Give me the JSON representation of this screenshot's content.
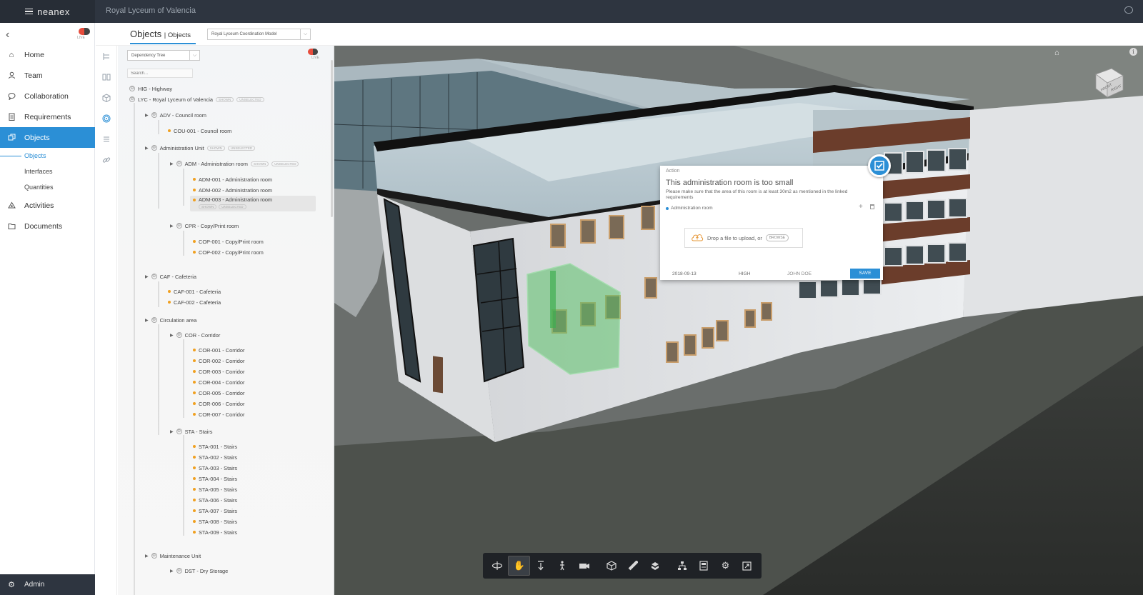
{
  "app": {
    "brand": "neanex",
    "project_title": "Royal Lyceum of Valencia"
  },
  "sidebar": {
    "toggle_label": "LIVE",
    "items": [
      {
        "label": "Home",
        "icon": "home-icon"
      },
      {
        "label": "Team",
        "icon": "user-icon"
      },
      {
        "label": "Collaboration",
        "icon": "chat-icon"
      },
      {
        "label": "Requirements",
        "icon": "clipboard-icon"
      },
      {
        "label": "Objects",
        "icon": "cube-icon",
        "active": true
      }
    ],
    "sub_items": [
      {
        "label": "Objects",
        "active": true
      },
      {
        "label": "Interfaces"
      },
      {
        "label": "Quantities"
      }
    ],
    "items_after": [
      {
        "label": "Activities",
        "icon": "activity-icon"
      },
      {
        "label": "Documents",
        "icon": "folder-icon"
      }
    ],
    "admin_label": "Admin"
  },
  "header": {
    "title": "Objects",
    "subtitle": "Objects",
    "model_select": "Royal Lyceum Coordination Model"
  },
  "tree": {
    "select": "Dependency Tree",
    "toggle_label": "LIVE",
    "search_placeholder": "Search...",
    "badge_shown": "SHOWN",
    "badge_unselected": "UNSELECTED",
    "rows": [
      {
        "label": "HIG - Highway"
      },
      {
        "label": "LYC - Royal Lyceum of Valencia"
      },
      {
        "label": "ADV - Council room"
      },
      {
        "label": "COU-001 - Council room"
      },
      {
        "label": "Administration Unit"
      },
      {
        "label": "ADM - Administration room"
      },
      {
        "label": "ADM-001 - Administration room"
      },
      {
        "label": "ADM-002 - Administration room"
      },
      {
        "label": "ADM-003 - Administration room"
      },
      {
        "label": "CPR - Copy/Print room"
      },
      {
        "label": "COP-001 - Copy/Print room"
      },
      {
        "label": "COP-002 - Copy/Print room"
      },
      {
        "label": "CAF - Cafeteria"
      },
      {
        "label": "CAF-001 - Cafeteria"
      },
      {
        "label": "CAF-002 - Cafeteria"
      },
      {
        "label": "Circulation area"
      },
      {
        "label": "COR - Corridor"
      },
      {
        "label": "COR-001 - Corridor"
      },
      {
        "label": "COR-002 - Corridor"
      },
      {
        "label": "COR-003 - Corridor"
      },
      {
        "label": "COR-004 - Corridor"
      },
      {
        "label": "COR-005 - Corridor"
      },
      {
        "label": "COR-006 - Corridor"
      },
      {
        "label": "COR-007 - Corridor"
      },
      {
        "label": "STA - Stairs"
      },
      {
        "label": "STA-001 - Stairs"
      },
      {
        "label": "STA-002 - Stairs"
      },
      {
        "label": "STA-003 - Stairs"
      },
      {
        "label": "STA-004 - Stairs"
      },
      {
        "label": "STA-005 - Stairs"
      },
      {
        "label": "STA-006 - Stairs"
      },
      {
        "label": "STA-007 - Stairs"
      },
      {
        "label": "STA-008 - Stairs"
      },
      {
        "label": "STA-009 - Stairs"
      },
      {
        "label": "Maintenance Unit"
      },
      {
        "label": "DST - Dry Storage"
      }
    ]
  },
  "action_card": {
    "label": "Action",
    "title": "This administration room is too small",
    "description": "Please make sure that the area of this room is at least 30m2 as mentioned in the linked requirements",
    "linked_object": "Administration room",
    "upload_text": "Drop a file to upload, or",
    "browse_label": "BROWSE",
    "date": "2018-09-13",
    "priority": "HIGH",
    "assignee": "JOHN DOE",
    "save_label": "SAVE"
  },
  "viewcube": {
    "front": "FRONT",
    "right": "RIGHT"
  },
  "colors": {
    "accent": "#2b8fd6",
    "topbar": "#2e3540",
    "tree_dot": "#f0a020",
    "highlight_green": "#5cc26a"
  }
}
